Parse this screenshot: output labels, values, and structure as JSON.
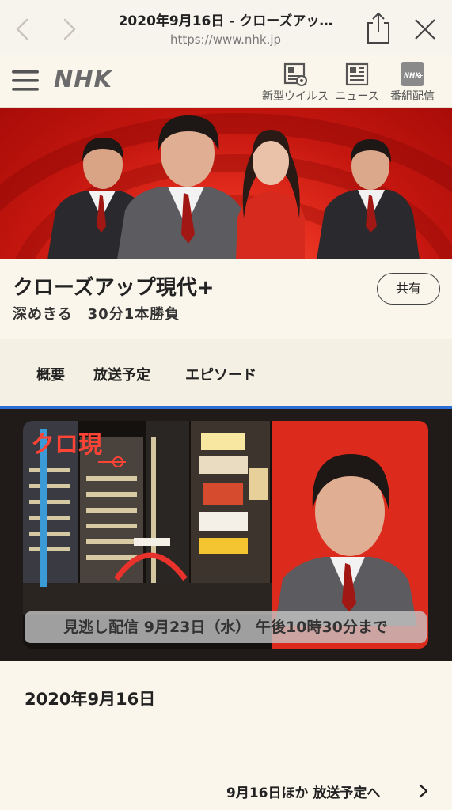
{
  "browser": {
    "title": "2020年9月16日 - クローズアッ…",
    "url": "https://www.nhk.jp"
  },
  "header": {
    "logo": "NHK",
    "links": [
      {
        "label": "新型ウイルス",
        "icon": "corona-news-icon"
      },
      {
        "label": "ニュース",
        "icon": "newspaper-icon"
      },
      {
        "label": "番組配信",
        "icon": "nhk-plus-icon"
      }
    ]
  },
  "program": {
    "title": "クローズアップ現代+",
    "subtitle": "深めきる　30分1本勝負",
    "share_label": "共有"
  },
  "tabs": [
    {
      "label": "概要"
    },
    {
      "label": "放送予定"
    },
    {
      "label": "エピソード"
    }
  ],
  "video": {
    "logo_text": "クロ現",
    "availability": "見逃し配信 9月23日（水） 午後10時30分まで"
  },
  "episode": {
    "date": "2020年9月16日",
    "schedule_link": "9月16日ほか 放送予定へ"
  },
  "colors": {
    "accent_red": "#e42d1e",
    "video_border": "#2b6fd6",
    "background": "#fbf6eb"
  }
}
